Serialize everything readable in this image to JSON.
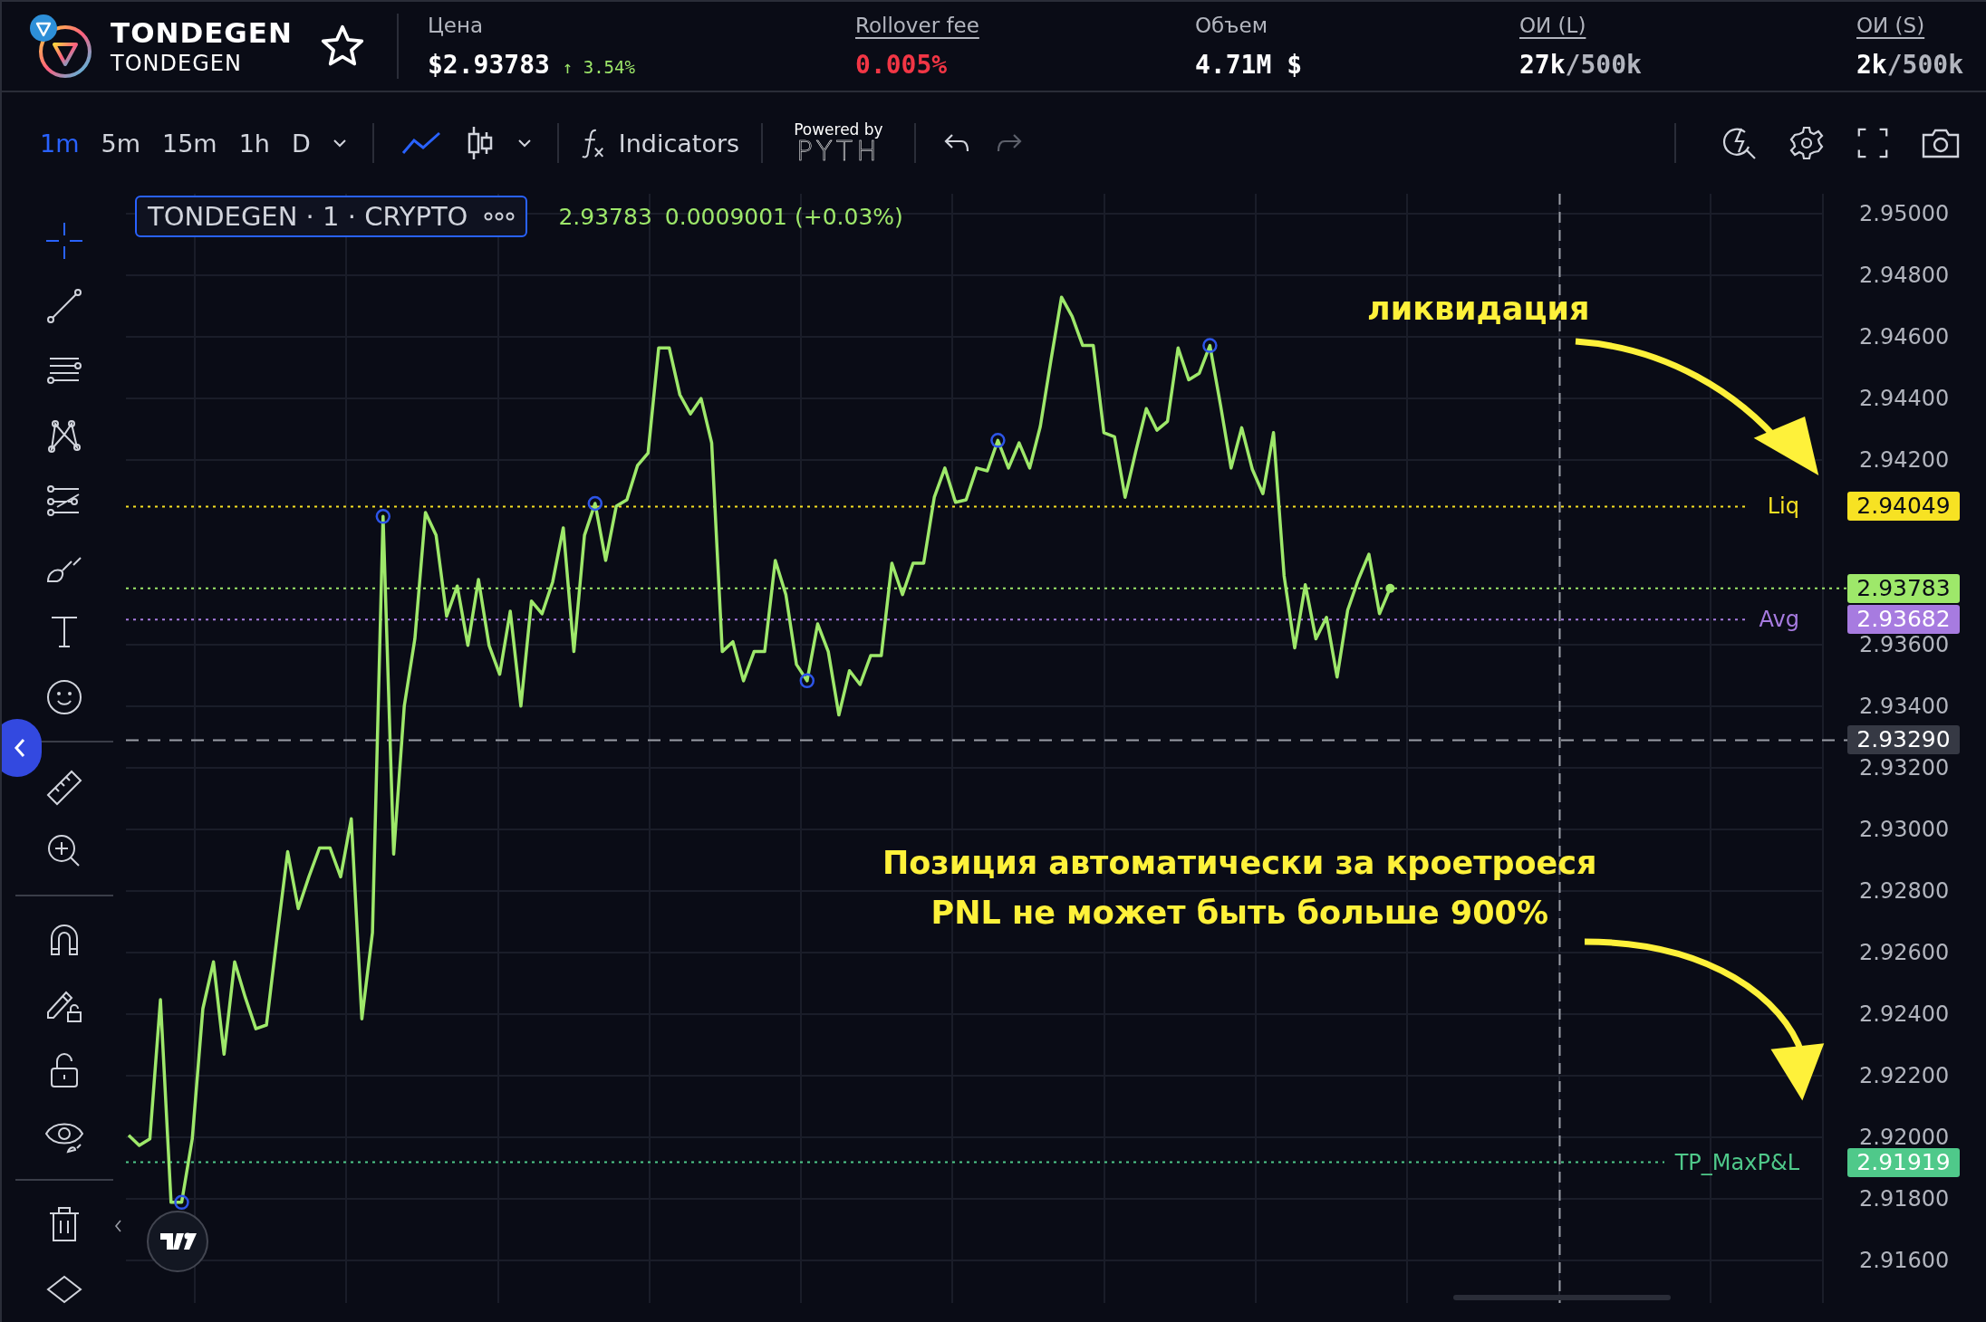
{
  "header": {
    "symbol": "TONDEGEN",
    "subtitle": "TONDEGEN",
    "favorite": false,
    "stats": [
      {
        "kind": "price",
        "label": "Цена",
        "value": "$2.93783",
        "change": "↑ 3.54%"
      },
      {
        "kind": "fee",
        "label": "Rollover fee",
        "value": "0.005%"
      },
      {
        "kind": "plain",
        "label": "Объем",
        "value": "4.71M $"
      },
      {
        "kind": "ratio",
        "label": "ОИ (L)",
        "value": "27k",
        "limit": "/500k"
      },
      {
        "kind": "ratio",
        "label": "ОИ (S)",
        "value": "2k",
        "limit": "/500k"
      }
    ]
  },
  "toolbar": {
    "intervals": [
      {
        "label": "1m",
        "selected": true
      },
      {
        "label": "5m",
        "selected": false
      },
      {
        "label": "15m",
        "selected": false
      },
      {
        "label": "1h",
        "selected": false
      },
      {
        "label": "D",
        "selected": false
      }
    ],
    "chart_types": [
      {
        "kind": "line",
        "selected": true
      },
      {
        "kind": "candles",
        "selected": false
      }
    ],
    "indicators": "Indicators",
    "powered_by": "Powered by",
    "provider": "PYTH",
    "redo_disabled": true
  },
  "drawing_tools": [
    {
      "kind": "crosshair",
      "selected": true
    },
    {
      "kind": "trend-line",
      "selected": false
    },
    {
      "kind": "parallel-lines",
      "selected": false
    },
    {
      "kind": "pattern",
      "selected": false
    },
    {
      "kind": "fib",
      "selected": false
    },
    {
      "kind": "brush",
      "selected": false
    },
    {
      "kind": "text",
      "selected": false
    },
    {
      "kind": "emoji",
      "selected": false
    },
    {
      "kind": "separator"
    },
    {
      "kind": "ruler",
      "selected": false
    },
    {
      "kind": "zoom",
      "selected": false
    },
    {
      "kind": "separator"
    },
    {
      "kind": "magnet",
      "selected": false
    },
    {
      "kind": "pencil-lock",
      "selected": false
    },
    {
      "kind": "lock",
      "selected": false
    },
    {
      "kind": "eye",
      "selected": false
    },
    {
      "kind": "separator"
    },
    {
      "kind": "trash",
      "selected": false
    },
    {
      "kind": "layers",
      "selected": false
    }
  ],
  "legend": {
    "title": "TONDEGEN · 1 · CRYPTO",
    "last": "2.93783",
    "change": "0.0009001 (+0.03%)"
  },
  "chart": {
    "chart_data": {
      "type": "line",
      "grid": true,
      "ylim": [
        2.91462,
        2.95065
      ],
      "yticks": [
        {
          "value": 2.95,
          "label": "2.95000"
        },
        {
          "value": 2.948,
          "label": "2.94800"
        },
        {
          "value": 2.946,
          "label": "2.94600"
        },
        {
          "value": 2.944,
          "label": "2.94400"
        },
        {
          "value": 2.942,
          "label": "2.94200"
        },
        {
          "value": 2.936,
          "label": "2.93600"
        },
        {
          "value": 2.934,
          "label": "2.93400"
        },
        {
          "value": 2.932,
          "label": "2.93200"
        },
        {
          "value": 2.93,
          "label": "2.93000"
        },
        {
          "value": 2.928,
          "label": "2.92800"
        },
        {
          "value": 2.926,
          "label": "2.92600"
        },
        {
          "value": 2.924,
          "label": "2.92400"
        },
        {
          "value": 2.922,
          "label": "2.92200"
        },
        {
          "value": 2.92,
          "label": "2.92000"
        },
        {
          "value": 2.918,
          "label": "2.91800"
        },
        {
          "value": 2.916,
          "label": "2.91600"
        }
      ],
      "series": [
        {
          "color": "#9ee86a",
          "values": [
            2.92007,
            2.91974,
            2.91995,
            2.92447,
            2.91789,
            2.91789,
            2.91995,
            2.92418,
            2.9257,
            2.9227,
            2.9257,
            2.92455,
            2.92353,
            2.92365,
            2.92653,
            2.92928,
            2.92743,
            2.92846,
            2.9294,
            2.9294,
            2.92846,
            2.93035,
            2.92385,
            2.92665,
            2.94017,
            2.9292,
            2.93401,
            2.93619,
            2.9403,
            2.93956,
            2.93693,
            2.93791,
            2.93598,
            2.93812,
            2.93598,
            2.93504,
            2.93709,
            2.93401,
            2.93742,
            2.93701,
            2.93804,
            2.9398,
            2.93578,
            2.93956,
            2.94059,
            2.93874,
            2.9405,
            2.94071,
            2.94182,
            2.94223,
            2.94564,
            2.94564,
            2.94412,
            2.9435,
            2.944,
            2.94256,
            2.93578,
            2.9361,
            2.93483,
            2.93578,
            2.93578,
            2.93874,
            2.93763,
            2.93536,
            2.93483,
            2.93668,
            2.93578,
            2.93372,
            2.93516,
            2.93471,
            2.93565,
            2.93565,
            2.93865,
            2.93763,
            2.93865,
            2.93865,
            2.94079,
            2.94174,
            2.94063,
            2.94071,
            2.94174,
            2.94165,
            2.94264,
            2.94174,
            2.94256,
            2.94174,
            2.94309,
            2.94523,
            2.94729,
            2.94667,
            2.94572,
            2.94572,
            2.94289,
            2.94276,
            2.94079,
            2.94227,
            2.94367,
            2.94297,
            2.94326,
            2.94564,
            2.94461,
            2.94482,
            2.94572,
            2.94379,
            2.94174,
            2.94305,
            2.9417,
            2.94091,
            2.94289,
            2.93824,
            2.9359,
            2.93795,
            2.93619,
            2.93689,
            2.93495,
            2.93713,
            2.93812,
            2.93894,
            2.93701,
            2.93783
          ]
        }
      ],
      "ref_lines": [
        {
          "axis": "y",
          "value": 2.94049,
          "label": "Liq",
          "color": "#f7e223"
        },
        {
          "axis": "y",
          "value": 2.93783,
          "color": "#9ee86a"
        },
        {
          "axis": "y",
          "value": 2.93682,
          "label": "Avg",
          "color": "#a77be0"
        },
        {
          "axis": "y",
          "value": 2.9329,
          "color": "#9a9da6"
        },
        {
          "axis": "y",
          "value": 2.91919,
          "label": "TP_MaxP&L",
          "color": "#4fc98a"
        }
      ]
    },
    "price_tags": [
      {
        "value": "2.94049",
        "color": "#f7e223"
      },
      {
        "value": "2.93783",
        "color": "#9ee86a"
      },
      {
        "value": "2.93682",
        "color": "#a77be0"
      },
      {
        "value": "2.93290",
        "color": "#363944"
      },
      {
        "value": "2.91919",
        "color": "#4fc98a"
      }
    ],
    "notes": [
      {
        "kind": "top",
        "lines": [
          "ликвидация"
        ]
      },
      {
        "kind": "bottom",
        "lines": [
          "Позиция автоматически за кроетроеся",
          "PNL не может быть больше 900%"
        ]
      }
    ]
  }
}
